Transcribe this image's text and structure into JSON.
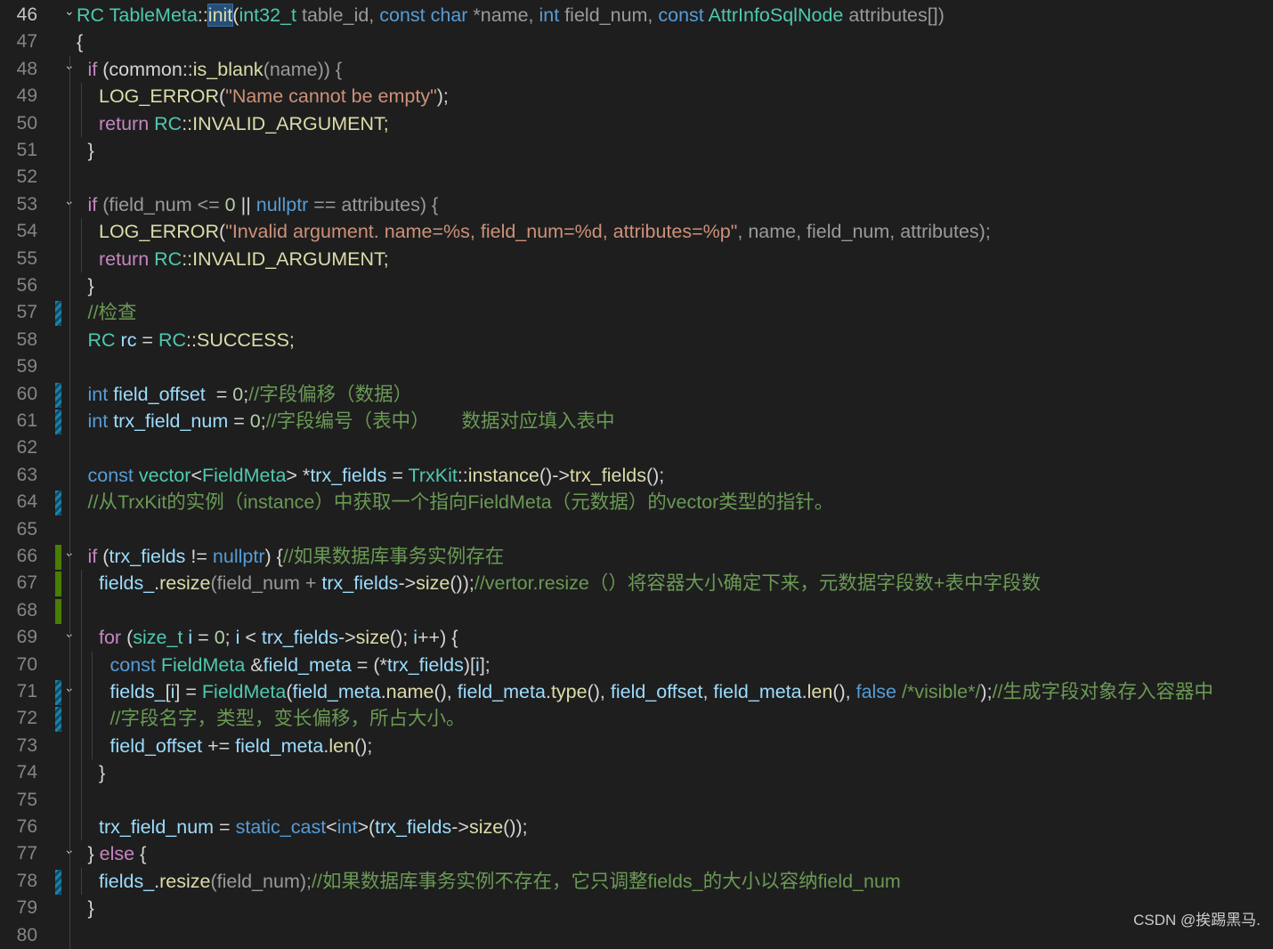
{
  "editor": {
    "active_line": 46,
    "lines": [
      {
        "n": 46,
        "indent": 0,
        "fold": true,
        "mark": "",
        "tokens": [
          [
            "RC ",
            "t"
          ],
          [
            "TableMeta",
            "t"
          ],
          [
            "::",
            "p"
          ],
          [
            "init",
            "f",
            "sel"
          ],
          [
            "(",
            "p"
          ],
          [
            "int32_t",
            "t"
          ],
          [
            " table_id, ",
            "g"
          ],
          [
            "const char",
            "k"
          ],
          [
            " *name, ",
            "g"
          ],
          [
            "int",
            "k"
          ],
          [
            " field_num, ",
            "g"
          ],
          [
            "const ",
            "k"
          ],
          [
            "AttrInfoSqlNode",
            "t"
          ],
          [
            " attributes[])",
            "g"
          ]
        ]
      },
      {
        "n": 47,
        "indent": 0,
        "fold": false,
        "mark": "",
        "tokens": [
          [
            "{",
            "p"
          ]
        ]
      },
      {
        "n": 48,
        "indent": 1,
        "fold": true,
        "mark": "",
        "tokens": [
          [
            "if",
            "c"
          ],
          [
            " (common::",
            "p"
          ],
          [
            "is_blank",
            "f"
          ],
          [
            "(name)) {",
            "g"
          ]
        ]
      },
      {
        "n": 49,
        "indent": 2,
        "fold": false,
        "mark": "",
        "tokens": [
          [
            "LOG_ERROR",
            "f"
          ],
          [
            "(",
            "p"
          ],
          [
            "\"Name cannot be empty\"",
            "s"
          ],
          [
            ");",
            "p"
          ]
        ]
      },
      {
        "n": 50,
        "indent": 2,
        "fold": false,
        "mark": "",
        "tokens": [
          [
            "return ",
            "c"
          ],
          [
            "RC",
            "t"
          ],
          [
            "::INVALID_ARGUMENT;",
            "f"
          ]
        ]
      },
      {
        "n": 51,
        "indent": 1,
        "fold": false,
        "mark": "",
        "tokens": [
          [
            "}",
            "p"
          ]
        ]
      },
      {
        "n": 52,
        "indent": 1,
        "fold": false,
        "mark": "",
        "tokens": []
      },
      {
        "n": 53,
        "indent": 1,
        "fold": true,
        "mark": "",
        "tokens": [
          [
            "if",
            "c"
          ],
          [
            " (field_num <= ",
            "g"
          ],
          [
            "0",
            "n"
          ],
          [
            " || ",
            "p"
          ],
          [
            "nullptr",
            "k"
          ],
          [
            " == attributes) {",
            "g"
          ]
        ]
      },
      {
        "n": 54,
        "indent": 2,
        "fold": false,
        "mark": "",
        "tokens": [
          [
            "LOG_ERROR",
            "f"
          ],
          [
            "(",
            "p"
          ],
          [
            "\"Invalid argument. name=%s, field_num=%d, attributes=%p\"",
            "s"
          ],
          [
            ", name, field_num, attributes);",
            "g"
          ]
        ]
      },
      {
        "n": 55,
        "indent": 2,
        "fold": false,
        "mark": "",
        "tokens": [
          [
            "return ",
            "c"
          ],
          [
            "RC",
            "t"
          ],
          [
            "::INVALID_ARGUMENT;",
            "f"
          ]
        ]
      },
      {
        "n": 56,
        "indent": 1,
        "fold": false,
        "mark": "",
        "tokens": [
          [
            "}",
            "p"
          ]
        ]
      },
      {
        "n": 57,
        "indent": 1,
        "fold": false,
        "mark": "mod",
        "tokens": [
          [
            "//检查",
            "m"
          ]
        ]
      },
      {
        "n": 58,
        "indent": 1,
        "fold": false,
        "mark": "",
        "tokens": [
          [
            "RC ",
            "t"
          ],
          [
            "rc",
            "v"
          ],
          [
            " = ",
            "p"
          ],
          [
            "RC",
            "t"
          ],
          [
            "::SUCCESS;",
            "f"
          ]
        ]
      },
      {
        "n": 59,
        "indent": 1,
        "fold": false,
        "mark": "",
        "tokens": []
      },
      {
        "n": 60,
        "indent": 1,
        "fold": false,
        "mark": "mod",
        "tokens": [
          [
            "int ",
            "k"
          ],
          [
            "field_offset",
            "v"
          ],
          [
            "  = ",
            "p"
          ],
          [
            "0",
            "n"
          ],
          [
            ";",
            "p"
          ],
          [
            "//字段偏移（数据）",
            "m"
          ]
        ]
      },
      {
        "n": 61,
        "indent": 1,
        "fold": false,
        "mark": "mod",
        "tokens": [
          [
            "int ",
            "k"
          ],
          [
            "trx_field_num",
            "v"
          ],
          [
            " = ",
            "p"
          ],
          [
            "0",
            "n"
          ],
          [
            ";",
            "p"
          ],
          [
            "//字段编号（表中）      数据对应填入表中",
            "m"
          ]
        ]
      },
      {
        "n": 62,
        "indent": 1,
        "fold": false,
        "mark": "",
        "tokens": []
      },
      {
        "n": 63,
        "indent": 1,
        "fold": false,
        "mark": "",
        "tokens": [
          [
            "const ",
            "k"
          ],
          [
            "vector",
            "t"
          ],
          [
            "<",
            "p"
          ],
          [
            "FieldMeta",
            "t"
          ],
          [
            "> *",
            "p"
          ],
          [
            "trx_fields",
            "v"
          ],
          [
            " = ",
            "p"
          ],
          [
            "TrxKit",
            "t"
          ],
          [
            "::",
            "p"
          ],
          [
            "instance",
            "f"
          ],
          [
            "()->",
            "p"
          ],
          [
            "trx_fields",
            "f"
          ],
          [
            "();",
            "p"
          ]
        ]
      },
      {
        "n": 64,
        "indent": 1,
        "fold": false,
        "mark": "mod",
        "tokens": [
          [
            "//从TrxKit的实例（instance）中获取一个指向FieldMeta（元数据）的vector类型的指针。",
            "m"
          ]
        ]
      },
      {
        "n": 65,
        "indent": 1,
        "fold": false,
        "mark": "",
        "tokens": []
      },
      {
        "n": 66,
        "indent": 1,
        "fold": true,
        "mark": "add",
        "tokens": [
          [
            "if",
            "c"
          ],
          [
            " (",
            "p"
          ],
          [
            "trx_fields",
            "v"
          ],
          [
            " != ",
            "p"
          ],
          [
            "nullptr",
            "k"
          ],
          [
            ") {",
            "p"
          ],
          [
            "//如果数据库事务实例存在",
            "m"
          ]
        ]
      },
      {
        "n": 67,
        "indent": 2,
        "fold": false,
        "mark": "add",
        "tokens": [
          [
            "fields_",
            "v"
          ],
          [
            ".",
            "p"
          ],
          [
            "resize",
            "f"
          ],
          [
            "(field_num + ",
            "g"
          ],
          [
            "trx_fields",
            "v"
          ],
          [
            "->",
            "p"
          ],
          [
            "size",
            "f"
          ],
          [
            "());",
            "p"
          ],
          [
            "//vertor.resize（）将容器大小确定下来，元数据字段数+表中字段数",
            "m"
          ]
        ]
      },
      {
        "n": 68,
        "indent": 2,
        "fold": false,
        "mark": "add",
        "tokens": []
      },
      {
        "n": 69,
        "indent": 2,
        "fold": true,
        "mark": "",
        "tokens": [
          [
            "for",
            "c"
          ],
          [
            " (",
            "p"
          ],
          [
            "size_t",
            "t"
          ],
          [
            " ",
            "p"
          ],
          [
            "i",
            "v"
          ],
          [
            " = ",
            "p"
          ],
          [
            "0",
            "n"
          ],
          [
            "; ",
            "p"
          ],
          [
            "i",
            "v"
          ],
          [
            " < ",
            "p"
          ],
          [
            "trx_fields",
            "v"
          ],
          [
            "->",
            "p"
          ],
          [
            "size",
            "f"
          ],
          [
            "(); ",
            "p"
          ],
          [
            "i",
            "v"
          ],
          [
            "++) {",
            "p"
          ]
        ]
      },
      {
        "n": 70,
        "indent": 3,
        "fold": false,
        "mark": "",
        "tokens": [
          [
            "const ",
            "k"
          ],
          [
            "FieldMeta",
            "t"
          ],
          [
            " &",
            "p"
          ],
          [
            "field_meta",
            "v"
          ],
          [
            " = (*",
            "p"
          ],
          [
            "trx_fields",
            "v"
          ],
          [
            ")[",
            "p"
          ],
          [
            "i",
            "v"
          ],
          [
            "];",
            "p"
          ]
        ]
      },
      {
        "n": 71,
        "indent": 3,
        "fold": true,
        "mark": "mod",
        "tokens": [
          [
            "fields_",
            "v"
          ],
          [
            "[",
            "p"
          ],
          [
            "i",
            "v"
          ],
          [
            "] = ",
            "p"
          ],
          [
            "FieldMeta",
            "t"
          ],
          [
            "(",
            "p"
          ],
          [
            "field_meta",
            "v"
          ],
          [
            ".",
            "p"
          ],
          [
            "name",
            "f"
          ],
          [
            "(), ",
            "p"
          ],
          [
            "field_meta",
            "v"
          ],
          [
            ".",
            "p"
          ],
          [
            "type",
            "f"
          ],
          [
            "(), ",
            "p"
          ],
          [
            "field_offset",
            "v"
          ],
          [
            ", ",
            "p"
          ],
          [
            "field_meta",
            "v"
          ],
          [
            ".",
            "p"
          ],
          [
            "len",
            "f"
          ],
          [
            "(), ",
            "p"
          ],
          [
            "false",
            "k"
          ],
          [
            " /*visible*/",
            "m"
          ],
          [
            ");",
            "p"
          ],
          [
            "//生成字段对象存入容器中",
            "m"
          ]
        ]
      },
      {
        "n": 72,
        "indent": 3,
        "fold": false,
        "mark": "mod",
        "tokens": [
          [
            "//字段名字，类型，变长偏移，所占大小。",
            "m"
          ]
        ]
      },
      {
        "n": 73,
        "indent": 3,
        "fold": false,
        "mark": "",
        "tokens": [
          [
            "field_offset",
            "v"
          ],
          [
            " += ",
            "p"
          ],
          [
            "field_meta",
            "v"
          ],
          [
            ".",
            "p"
          ],
          [
            "len",
            "f"
          ],
          [
            "();",
            "p"
          ]
        ]
      },
      {
        "n": 74,
        "indent": 2,
        "fold": false,
        "mark": "",
        "tokens": [
          [
            "}",
            "p"
          ]
        ]
      },
      {
        "n": 75,
        "indent": 2,
        "fold": false,
        "mark": "",
        "tokens": []
      },
      {
        "n": 76,
        "indent": 2,
        "fold": false,
        "mark": "",
        "tokens": [
          [
            "trx_field_num",
            "v"
          ],
          [
            " = ",
            "p"
          ],
          [
            "static_cast",
            "k"
          ],
          [
            "<",
            "p"
          ],
          [
            "int",
            "k"
          ],
          [
            ">(",
            "p"
          ],
          [
            "trx_fields",
            "v"
          ],
          [
            "->",
            "p"
          ],
          [
            "size",
            "f"
          ],
          [
            "());",
            "p"
          ]
        ]
      },
      {
        "n": 77,
        "indent": 1,
        "fold": true,
        "mark": "",
        "tokens": [
          [
            "} ",
            "p"
          ],
          [
            "else",
            "c"
          ],
          [
            " {",
            "p"
          ]
        ]
      },
      {
        "n": 78,
        "indent": 2,
        "fold": false,
        "mark": "mod",
        "tokens": [
          [
            "fields_",
            "v"
          ],
          [
            ".",
            "p"
          ],
          [
            "resize",
            "f"
          ],
          [
            "(field_num);",
            "g"
          ],
          [
            "//如果数据库事务实例不存在，它只调整fields_的大小以容纳field_num",
            "m"
          ]
        ]
      },
      {
        "n": 79,
        "indent": 1,
        "fold": false,
        "mark": "",
        "tokens": [
          [
            "}",
            "p"
          ]
        ]
      },
      {
        "n": 80,
        "indent": 1,
        "fold": false,
        "mark": "",
        "tokens": []
      }
    ]
  },
  "watermark": "CSDN @挨踢黑马."
}
